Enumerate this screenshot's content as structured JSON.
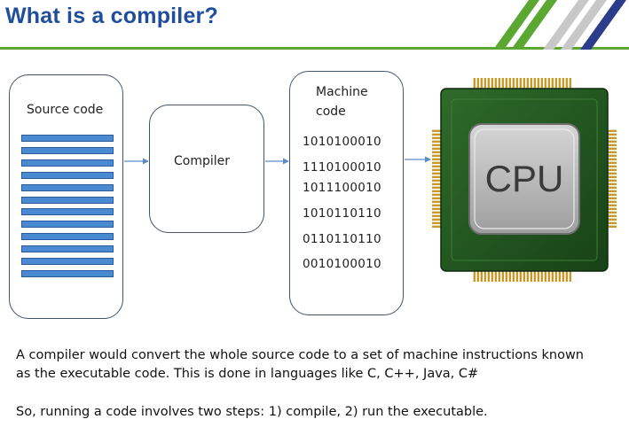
{
  "slide": {
    "title": "What is a compiler?",
    "colors": {
      "title": "#1f4e9c",
      "rule": "#5aa832",
      "code_bar": "#4a8ad2"
    }
  },
  "diagram": {
    "source_box": {
      "label": "Source code",
      "line_count": 12
    },
    "compiler_box": {
      "label": "Compiler"
    },
    "machine_box": {
      "label_line1": "Machine",
      "label_line2": "code",
      "lines": [
        "1010100010",
        "1110100010",
        "1011100010",
        "1010110110",
        "0110110110",
        "0010100010"
      ]
    },
    "cpu": {
      "label": "CPU"
    }
  },
  "text": {
    "para1_line1": "A compiler would convert the whole source code to a set of machine instructions known",
    "para1_line2": "as the executable code. This is done in languages like C, C++, Java, C#",
    "para2": "So, running a code involves two steps: 1) compile, 2) run the executable."
  }
}
